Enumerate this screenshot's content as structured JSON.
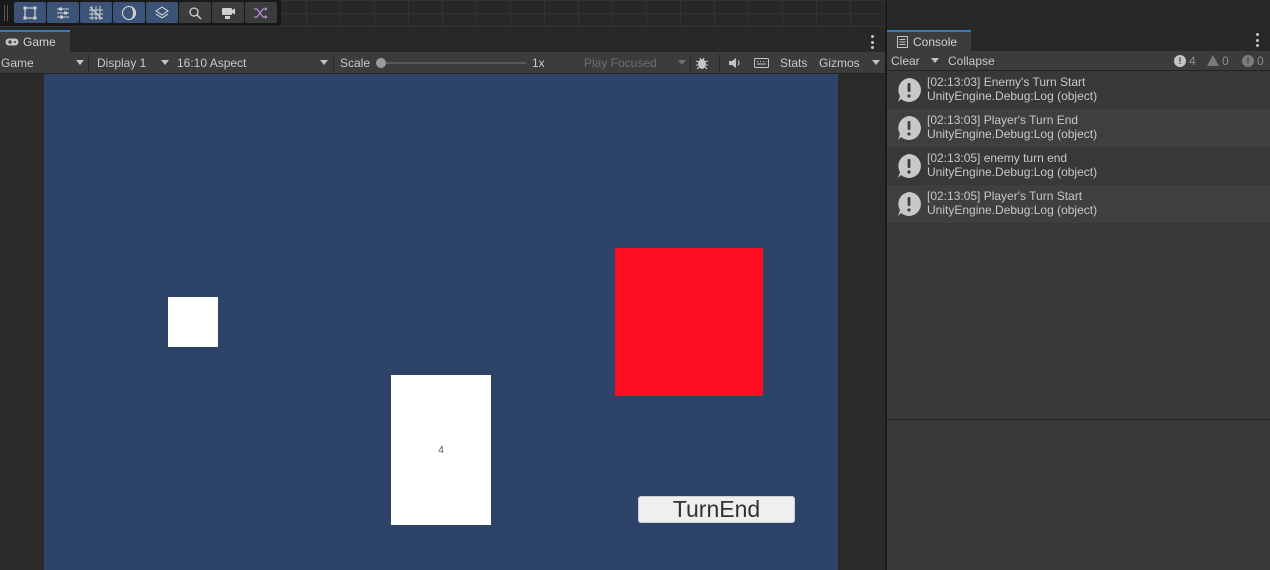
{
  "toolbar": {
    "tools": [
      {
        "icon": "rect-transform-icon"
      },
      {
        "icon": "align-icon"
      },
      {
        "icon": "grid-snap-icon"
      },
      {
        "icon": "shading-sphere-icon"
      },
      {
        "icon": "layers-icon"
      },
      {
        "icon": "magnifier-icon"
      },
      {
        "icon": "camera-icon"
      },
      {
        "icon": "shuffle-icon"
      }
    ],
    "accent": "#3a5377"
  },
  "game": {
    "tab_label": "Game",
    "toolbar": {
      "mode": "Game",
      "display": "Display 1",
      "aspect": "16:10 Aspect",
      "scale_label": "Scale",
      "scale_value": "1x",
      "play_focus": "Play Focused",
      "stats": "Stats",
      "gizmos": "Gizmos"
    },
    "scene": {
      "background": "#2e4368",
      "card_value": "4",
      "enemy_color": "#fc0d1f",
      "turn_end_label": "TurnEnd"
    }
  },
  "console": {
    "tab_label": "Console",
    "toolbar": {
      "clear": "Clear",
      "collapse": "Collapse",
      "log_count": "4",
      "warning_count": "0",
      "error_count": "0"
    },
    "entries": [
      {
        "message": "[02:13:03] Enemy's Turn Start",
        "source": "UnityEngine.Debug:Log (object)"
      },
      {
        "message": "[02:13:03] Player's Turn End",
        "source": "UnityEngine.Debug:Log (object)"
      },
      {
        "message": "[02:13:05] enemy turn end",
        "source": "UnityEngine.Debug:Log (object)"
      },
      {
        "message": "[02:13:05] Player's Turn Start",
        "source": "UnityEngine.Debug:Log (object)"
      }
    ]
  }
}
